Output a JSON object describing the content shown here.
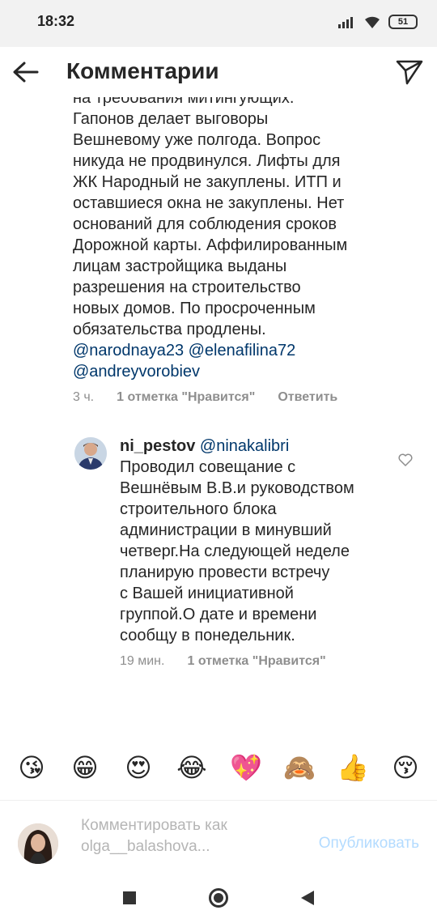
{
  "status_bar": {
    "time": "18:32",
    "battery": "51"
  },
  "header": {
    "title": "Комментарии"
  },
  "main_comment": {
    "text": "на требования митингующих.\nГапонов делает выговоры\nВешневому уже полгода. Вопрос\nникуда не продвинулся. Лифты для\nЖК Народный не закуплены. ИТП и\nоставшиеся окна не закуплены. Нет\nоснований для соблюдения сроков\nДорожной карты. Аффилированным\nлицам застройщика выданы\nразрешения на строительство\nновых домов. По просроченным\nобязательства продлены.",
    "mentions_line1": "@narodnaya23 @elenafilina72",
    "mentions_line2": "@andreyvorobiev",
    "time": "3 ч.",
    "likes": "1 отметка \"Нравится\"",
    "reply_label": "Ответить"
  },
  "reply_comment": {
    "username": "ni_pestov",
    "mention": "@ninakalibri",
    "text": "Проводил совещание с\nВешнёвым В.В.и руководством\nстроительного блока\nадминистрации в минувший\nчетверг.На следующей неделе\nпланирую провести встречу\nс Вашей инициативной\nгруппой.О дате и времени\nсообщу в понедельник.",
    "time": "19 мин.",
    "likes": "1 отметка \"Нравится\""
  },
  "emoji_bar": [
    "😘",
    "😁",
    "😍",
    "😂",
    "💖",
    "🙈",
    "👍",
    "😚"
  ],
  "comment_input": {
    "placeholder": "Комментировать как olga__balashova...",
    "publish_label": "Опубликовать"
  }
}
